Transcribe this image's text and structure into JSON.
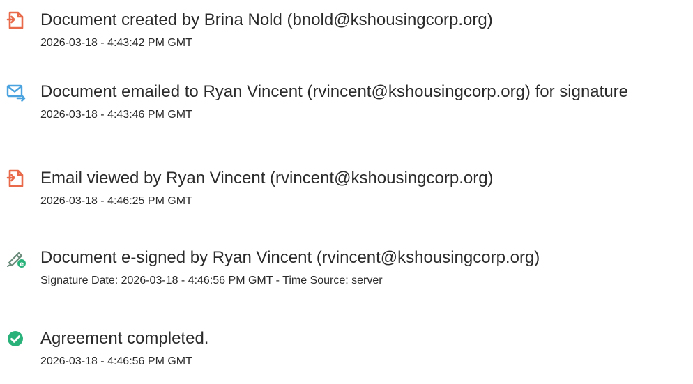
{
  "colors": {
    "doc_icon": "#e86a4a",
    "email_icon": "#4aa3df",
    "sign_icon": "#6a8a7a",
    "sign_badge": "#2ab27b",
    "check_icon": "#2ab27b",
    "text": "#2b2b2b"
  },
  "events": [
    {
      "icon": "document-icon",
      "title": "Document created by Brina Nold (bnold@kshousingcorp.org)",
      "timestamp": "2026-03-18 - 4:43:42 PM GMT"
    },
    {
      "icon": "email-icon",
      "title": "Document emailed to Ryan Vincent (rvincent@kshousingcorp.org) for signature",
      "timestamp": "2026-03-18 - 4:43:46 PM GMT"
    },
    {
      "icon": "document-icon",
      "title": "Email viewed by Ryan Vincent (rvincent@kshousingcorp.org)",
      "timestamp": "2026-03-18 - 4:46:25 PM GMT"
    },
    {
      "icon": "e-signature-icon",
      "title": "Document e-signed by Ryan Vincent (rvincent@kshousingcorp.org)",
      "timestamp": "Signature Date: 2026-03-18 - 4:46:56 PM GMT - Time Source: server"
    },
    {
      "icon": "checkmark-circle-icon",
      "title": "Agreement completed.",
      "timestamp": "2026-03-18 - 4:46:56 PM GMT"
    }
  ]
}
